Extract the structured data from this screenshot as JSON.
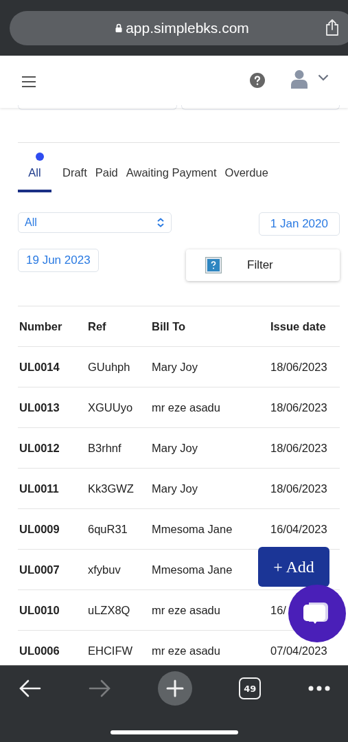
{
  "browser": {
    "url": "app.simplebks.com",
    "tab_count": "49"
  },
  "tabs": [
    {
      "label": "All",
      "selected": true,
      "dot": true
    },
    {
      "label": "Draft",
      "selected": false,
      "dot": false
    },
    {
      "label": "Paid",
      "selected": false,
      "dot": false
    },
    {
      "label": "Awaiting Payment",
      "selected": false,
      "dot": false
    },
    {
      "label": "Overdue",
      "selected": false,
      "dot": false
    }
  ],
  "filters": {
    "status_select": "All",
    "start_date": "1 Jan 2020",
    "end_date": "19 Jun 2023",
    "filter_button": "Filter"
  },
  "table": {
    "columns": [
      "Number",
      "Ref",
      "Bill To",
      "Issue date"
    ],
    "rows": [
      {
        "number": "UL0014",
        "ref": "GUuhph",
        "bill_to": "Mary Joy",
        "issue_date": "18/06/2023"
      },
      {
        "number": "UL0013",
        "ref": "XGUUyo",
        "bill_to": "mr eze asadu",
        "issue_date": "18/06/2023"
      },
      {
        "number": "UL0012",
        "ref": "B3rhnf",
        "bill_to": "Mary Joy",
        "issue_date": "18/06/2023"
      },
      {
        "number": "UL0011",
        "ref": "Kk3GWZ",
        "bill_to": "Mary Joy",
        "issue_date": "18/06/2023"
      },
      {
        "number": "UL0009",
        "ref": "6quR31",
        "bill_to": "Mmesoma Jane",
        "issue_date": "16/04/2023"
      },
      {
        "number": "UL0007",
        "ref": "xfybuv",
        "bill_to": "Mmesoma Jane"
      },
      {
        "number": "UL0010",
        "ref": "uLZX8Q",
        "bill_to": "mr eze asadu",
        "issue_date": "16/"
      },
      {
        "number": "UL0006",
        "ref": "EHCIFW",
        "bill_to": "mr eze asadu",
        "issue_date": "07/04/2023"
      }
    ]
  },
  "add_button": "+ Add"
}
